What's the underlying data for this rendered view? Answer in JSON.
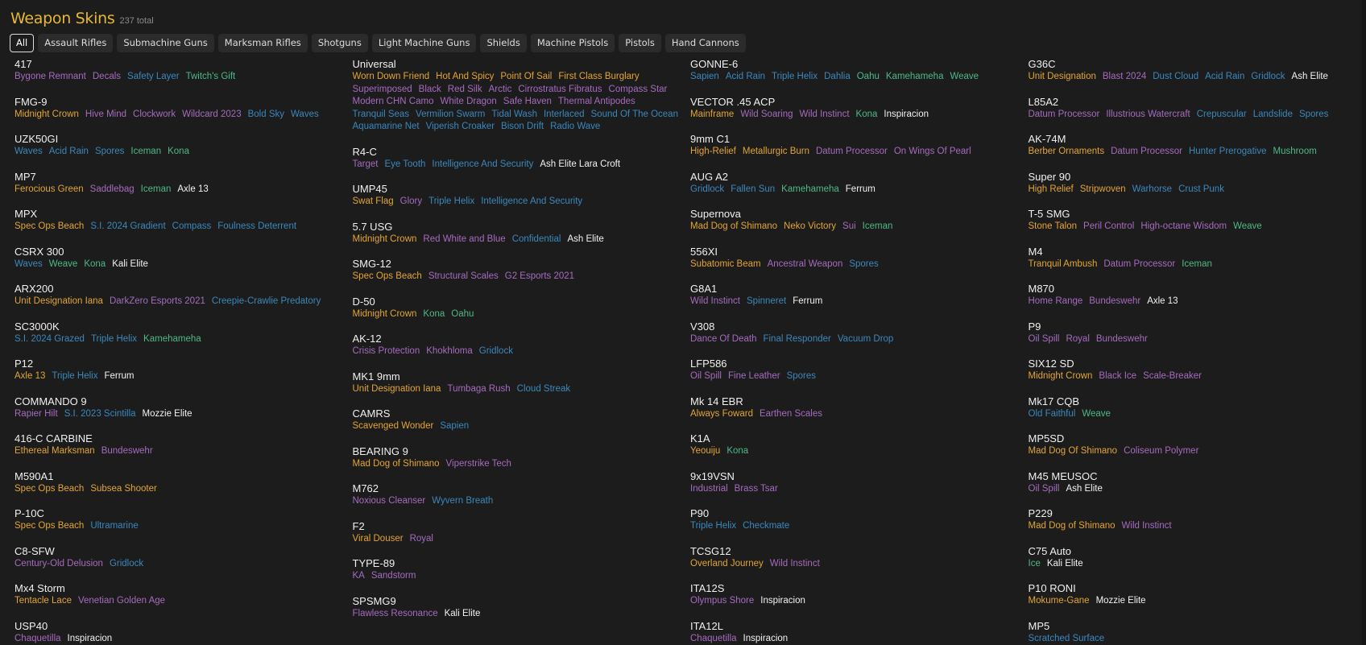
{
  "header": {
    "title": "Weapon Skins",
    "total": "237 total"
  },
  "tabs": [
    "All",
    "Assault Rifles",
    "Submachine Guns",
    "Marksman Rifles",
    "Shotguns",
    "Light Machine Guns",
    "Shields",
    "Machine Pistols",
    "Pistols",
    "Hand Cannons"
  ],
  "active_tab": "All",
  "rarity_colors": {
    "o": "#e3a534",
    "p": "#a66bbf",
    "b": "#3b88bd",
    "g": "#4db988",
    "w": "#f2f2f2"
  },
  "columns": [
    [
      {
        "name": "417",
        "skins": [
          [
            "Bygone Remnant",
            "p"
          ],
          [
            "Decals",
            "p"
          ],
          [
            "Safety Layer",
            "b"
          ],
          [
            "Twitch's Gift",
            "g"
          ]
        ]
      },
      {
        "name": "FMG-9",
        "skins": [
          [
            "Midnight Crown",
            "o"
          ],
          [
            "Hive Mind",
            "p"
          ],
          [
            "Clockwork",
            "p"
          ],
          [
            "Wildcard 2023",
            "p"
          ],
          [
            "Bold Sky",
            "b"
          ],
          [
            "Waves",
            "b"
          ]
        ]
      },
      {
        "name": "UZK50GI",
        "skins": [
          [
            "Waves",
            "b"
          ],
          [
            "Acid Rain",
            "b"
          ],
          [
            "Spores",
            "b"
          ],
          [
            "Iceman",
            "g"
          ],
          [
            "Kona",
            "g"
          ]
        ]
      },
      {
        "name": "MP7",
        "skins": [
          [
            "Ferocious Green",
            "o"
          ],
          [
            "Saddlebag",
            "p"
          ],
          [
            "Iceman",
            "g"
          ],
          [
            "Axle 13",
            "w"
          ]
        ]
      },
      {
        "name": "MPX",
        "skins": [
          [
            "Spec Ops Beach",
            "o"
          ],
          [
            "S.I. 2024 Gradient",
            "b"
          ],
          [
            "Compass",
            "b"
          ],
          [
            "Foulness Deterrent",
            "b"
          ]
        ]
      },
      {
        "name": "CSRX 300",
        "skins": [
          [
            "Waves",
            "b"
          ],
          [
            "Weave",
            "g"
          ],
          [
            "Kona",
            "g"
          ],
          [
            "Kali Elite",
            "w"
          ]
        ]
      },
      {
        "name": "ARX200",
        "skins": [
          [
            "Unit Designation Iana",
            "o"
          ],
          [
            "DarkZero Esports 2021",
            "p"
          ],
          [
            "Creepie-Crawlie Predatory",
            "b"
          ]
        ]
      },
      {
        "name": "SC3000K",
        "skins": [
          [
            "S.I. 2024 Grazed",
            "b"
          ],
          [
            "Triple Helix",
            "b"
          ],
          [
            "Kamehameha",
            "g"
          ]
        ]
      },
      {
        "name": "P12",
        "skins": [
          [
            "Axle 13",
            "o"
          ],
          [
            "Triple Helix",
            "b"
          ],
          [
            "Ferrum",
            "w"
          ]
        ]
      },
      {
        "name": "COMMANDO 9",
        "skins": [
          [
            "Rapier Hilt",
            "p"
          ],
          [
            "S.I. 2023 Scintilla",
            "b"
          ],
          [
            "Mozzie Elite",
            "w"
          ]
        ]
      },
      {
        "name": "416-C CARBINE",
        "skins": [
          [
            "Ethereal Marksman",
            "o"
          ],
          [
            "Bundeswehr",
            "p"
          ]
        ]
      },
      {
        "name": "M590A1",
        "skins": [
          [
            "Spec Ops Beach",
            "o"
          ],
          [
            "Subsea Shooter",
            "o"
          ]
        ]
      },
      {
        "name": "P-10C",
        "skins": [
          [
            "Spec Ops Beach",
            "o"
          ],
          [
            "Ultramarine",
            "b"
          ]
        ]
      },
      {
        "name": "C8-SFW",
        "skins": [
          [
            "Century-Old Delusion",
            "p"
          ],
          [
            "Gridlock",
            "b"
          ]
        ]
      },
      {
        "name": "Mx4 Storm",
        "skins": [
          [
            "Tentacle Lace",
            "o"
          ],
          [
            "Venetian Golden Age",
            "p"
          ]
        ]
      },
      {
        "name": "USP40",
        "skins": [
          [
            "Chaquetilla",
            "p"
          ],
          [
            "Inspiracion",
            "w"
          ]
        ]
      }
    ],
    [
      {
        "name": "Universal",
        "skins": [
          [
            "Worn Down Friend",
            "o"
          ],
          [
            "Hot And Spicy",
            "o"
          ],
          [
            "Point Of Sail",
            "o"
          ],
          [
            "First Class Burglary",
            "o"
          ],
          [
            "Superimposed",
            "p"
          ],
          [
            "Black",
            "p"
          ],
          [
            "Red Silk",
            "p"
          ],
          [
            "Arctic",
            "p"
          ],
          [
            "Cirrostratus Fibratus",
            "p"
          ],
          [
            "Compass Star",
            "p"
          ],
          [
            "Modern CHN Camo",
            "p"
          ],
          [
            "White Dragon",
            "p"
          ],
          [
            "Safe Haven",
            "p"
          ],
          [
            "Thermal Antipodes",
            "p"
          ],
          [
            "Tranquil Seas",
            "b"
          ],
          [
            "Vermilion Swarm",
            "b"
          ],
          [
            "Tidal Wash",
            "b"
          ],
          [
            "Interlaced",
            "b"
          ],
          [
            "Sound Of The Ocean",
            "b"
          ],
          [
            "Aquamarine Net",
            "b"
          ],
          [
            "Viperish Croaker",
            "b"
          ],
          [
            "Bison Drift",
            "b"
          ],
          [
            "Radio Wave",
            "b"
          ]
        ]
      },
      {
        "name": "R4-C",
        "skins": [
          [
            "Target",
            "p"
          ],
          [
            "Eye Tooth",
            "b"
          ],
          [
            "Intelligence And Security",
            "b"
          ],
          [
            "Ash Elite Lara Croft",
            "w"
          ]
        ]
      },
      {
        "name": "UMP45",
        "skins": [
          [
            "Swat Flag",
            "o"
          ],
          [
            "Glory",
            "p"
          ],
          [
            "Triple Helix",
            "b"
          ],
          [
            "Intelligence And Security",
            "b"
          ]
        ]
      },
      {
        "name": "5.7 USG",
        "skins": [
          [
            "Midnight Crown",
            "o"
          ],
          [
            "Red White and Blue",
            "p"
          ],
          [
            "Confidential",
            "b"
          ],
          [
            "Ash Elite",
            "w"
          ]
        ]
      },
      {
        "name": "SMG-12",
        "skins": [
          [
            "Spec Ops Beach",
            "o"
          ],
          [
            "Structural Scales",
            "p"
          ],
          [
            "G2 Esports 2021",
            "p"
          ]
        ]
      },
      {
        "name": "D-50",
        "skins": [
          [
            "Midnight Crown",
            "o"
          ],
          [
            "Kona",
            "g"
          ],
          [
            "Oahu",
            "g"
          ]
        ]
      },
      {
        "name": "AK-12",
        "skins": [
          [
            "Crisis Protection",
            "p"
          ],
          [
            "Khokhloma",
            "p"
          ],
          [
            "Gridlock",
            "b"
          ]
        ]
      },
      {
        "name": "MK1 9mm",
        "skins": [
          [
            "Unit Designation Iana",
            "o"
          ],
          [
            "Tumbaga Rush",
            "p"
          ],
          [
            "Cloud Streak",
            "b"
          ]
        ]
      },
      {
        "name": "CAMRS",
        "skins": [
          [
            "Scavenged Wonder",
            "o"
          ],
          [
            "Sapien",
            "b"
          ]
        ]
      },
      {
        "name": "BEARING 9",
        "skins": [
          [
            "Mad Dog of Shimano",
            "o"
          ],
          [
            "Viperstrike Tech",
            "p"
          ]
        ]
      },
      {
        "name": "M762",
        "skins": [
          [
            "Noxious Cleanser",
            "p"
          ],
          [
            "Wyvern Breath",
            "b"
          ]
        ]
      },
      {
        "name": "F2",
        "skins": [
          [
            "Viral Douser",
            "o"
          ],
          [
            "Royal",
            "p"
          ]
        ]
      },
      {
        "name": "TYPE-89",
        "skins": [
          [
            "KA",
            "p"
          ],
          [
            "Sandstorm",
            "p"
          ]
        ]
      },
      {
        "name": "SPSMG9",
        "skins": [
          [
            "Flawless Resonance",
            "p"
          ],
          [
            "Kali Elite",
            "w"
          ]
        ]
      }
    ],
    [
      {
        "name": "GONNE-6",
        "skins": [
          [
            "Sapien",
            "b"
          ],
          [
            "Acid Rain",
            "b"
          ],
          [
            "Triple Helix",
            "b"
          ],
          [
            "Dahlia",
            "b"
          ],
          [
            "Oahu",
            "g"
          ],
          [
            "Kamehameha",
            "g"
          ],
          [
            "Weave",
            "g"
          ]
        ]
      },
      {
        "name": "VECTOR .45 ACP",
        "skins": [
          [
            "Mainframe",
            "o"
          ],
          [
            "Wild Soaring",
            "p"
          ],
          [
            "Wild Instinct",
            "p"
          ],
          [
            "Kona",
            "g"
          ],
          [
            "Inspiracion",
            "w"
          ]
        ]
      },
      {
        "name": "9mm C1",
        "skins": [
          [
            "High-Relief",
            "o"
          ],
          [
            "Metallurgic Burn",
            "o"
          ],
          [
            "Datum Processor",
            "p"
          ],
          [
            "On Wings Of Pearl",
            "p"
          ]
        ]
      },
      {
        "name": "AUG A2",
        "skins": [
          [
            "Gridlock",
            "b"
          ],
          [
            "Fallen Sun",
            "b"
          ],
          [
            "Kamehameha",
            "g"
          ],
          [
            "Ferrum",
            "w"
          ]
        ]
      },
      {
        "name": "Supernova",
        "skins": [
          [
            "Mad Dog of Shimano",
            "o"
          ],
          [
            "Neko Victory",
            "o"
          ],
          [
            "Sui",
            "p"
          ],
          [
            "Iceman",
            "g"
          ]
        ]
      },
      {
        "name": "556XI",
        "skins": [
          [
            "Subatomic Beam",
            "o"
          ],
          [
            "Ancestral Weapon",
            "p"
          ],
          [
            "Spores",
            "b"
          ]
        ]
      },
      {
        "name": "G8A1",
        "skins": [
          [
            "Wild Instinct",
            "p"
          ],
          [
            "Spinneret",
            "b"
          ],
          [
            "Ferrum",
            "w"
          ]
        ]
      },
      {
        "name": "V308",
        "skins": [
          [
            "Dance Of Death",
            "p"
          ],
          [
            "Final Responder",
            "b"
          ],
          [
            "Vacuum Drop",
            "b"
          ]
        ]
      },
      {
        "name": "LFP586",
        "skins": [
          [
            "Oil Spill",
            "p"
          ],
          [
            "Fine Leather",
            "p"
          ],
          [
            "Spores",
            "b"
          ]
        ]
      },
      {
        "name": "Mk 14 EBR",
        "skins": [
          [
            "Always Foward",
            "o"
          ],
          [
            "Earthen Scales",
            "p"
          ]
        ]
      },
      {
        "name": "K1A",
        "skins": [
          [
            "Yeouiju",
            "o"
          ],
          [
            "Kona",
            "g"
          ]
        ]
      },
      {
        "name": "9x19VSN",
        "skins": [
          [
            "Industrial",
            "p"
          ],
          [
            "Brass Tsar",
            "p"
          ]
        ]
      },
      {
        "name": "P90",
        "skins": [
          [
            "Triple Helix",
            "b"
          ],
          [
            "Checkmate",
            "b"
          ]
        ]
      },
      {
        "name": "TCSG12",
        "skins": [
          [
            "Overland Journey",
            "o"
          ],
          [
            "Wild Instinct",
            "p"
          ]
        ]
      },
      {
        "name": "ITA12S",
        "skins": [
          [
            "Olympus Shore",
            "p"
          ],
          [
            "Inspiracion",
            "w"
          ]
        ]
      },
      {
        "name": "ITA12L",
        "skins": [
          [
            "Chaquetilla",
            "p"
          ],
          [
            "Inspiracion",
            "w"
          ]
        ]
      }
    ],
    [
      {
        "name": "G36C",
        "skins": [
          [
            "Unit Designation",
            "o"
          ],
          [
            "Blast 2024",
            "p"
          ],
          [
            "Dust Cloud",
            "b"
          ],
          [
            "Acid Rain",
            "b"
          ],
          [
            "Gridlock",
            "b"
          ],
          [
            "Ash Elite",
            "w"
          ]
        ]
      },
      {
        "name": "L85A2",
        "skins": [
          [
            "Datum Processor",
            "p"
          ],
          [
            "Illustrious Watercraft",
            "p"
          ],
          [
            "Crepuscular",
            "b"
          ],
          [
            "Landslide",
            "b"
          ],
          [
            "Spores",
            "b"
          ]
        ]
      },
      {
        "name": "AK-74M",
        "skins": [
          [
            "Berber Ornaments",
            "o"
          ],
          [
            "Datum Processor",
            "p"
          ],
          [
            "Hunter Prerogative",
            "b"
          ],
          [
            "Mushroom",
            "g"
          ]
        ]
      },
      {
        "name": "Super 90",
        "skins": [
          [
            "High Relief",
            "o"
          ],
          [
            "Stripwoven",
            "o"
          ],
          [
            "Warhorse",
            "b"
          ],
          [
            "Crust Punk",
            "b"
          ]
        ]
      },
      {
        "name": "T-5 SMG",
        "skins": [
          [
            "Stone Talon",
            "o"
          ],
          [
            "Peril Control",
            "p"
          ],
          [
            "High-octane Wisdom",
            "p"
          ],
          [
            "Weave",
            "g"
          ]
        ]
      },
      {
        "name": "M4",
        "skins": [
          [
            "Tranquil Ambush",
            "o"
          ],
          [
            "Datum Processor",
            "p"
          ],
          [
            "Iceman",
            "g"
          ]
        ]
      },
      {
        "name": "M870",
        "skins": [
          [
            "Home Range",
            "p"
          ],
          [
            "Bundeswehr",
            "p"
          ],
          [
            "Axle 13",
            "w"
          ]
        ]
      },
      {
        "name": "P9",
        "skins": [
          [
            "Oil Spill",
            "p"
          ],
          [
            "Royal",
            "p"
          ],
          [
            "Bundeswehr",
            "p"
          ]
        ]
      },
      {
        "name": "SIX12 SD",
        "skins": [
          [
            "Midnight Crown",
            "o"
          ],
          [
            "Black Ice",
            "p"
          ],
          [
            "Scale-Breaker",
            "p"
          ]
        ]
      },
      {
        "name": "Mk17 CQB",
        "skins": [
          [
            "Old Faithful",
            "b"
          ],
          [
            "Weave",
            "g"
          ]
        ]
      },
      {
        "name": "MP5SD",
        "skins": [
          [
            "Mad Dog Of Shimano",
            "o"
          ],
          [
            "Coliseum Polymer",
            "p"
          ]
        ]
      },
      {
        "name": "M45 MEUSOC",
        "skins": [
          [
            "Oil Spill",
            "p"
          ],
          [
            "Ash Elite",
            "w"
          ]
        ]
      },
      {
        "name": "P229",
        "skins": [
          [
            "Mad Dog of Shimano",
            "o"
          ],
          [
            "Wild Instinct",
            "p"
          ]
        ]
      },
      {
        "name": "C75 Auto",
        "skins": [
          [
            "Ice",
            "g"
          ],
          [
            "Kali Elite",
            "w"
          ]
        ]
      },
      {
        "name": "P10 RONI",
        "skins": [
          [
            "Mokume-Gane",
            "o"
          ],
          [
            "Mozzie Elite",
            "w"
          ]
        ]
      },
      {
        "name": "MP5",
        "skins": [
          [
            "Scratched Surface",
            "b"
          ]
        ]
      }
    ]
  ]
}
